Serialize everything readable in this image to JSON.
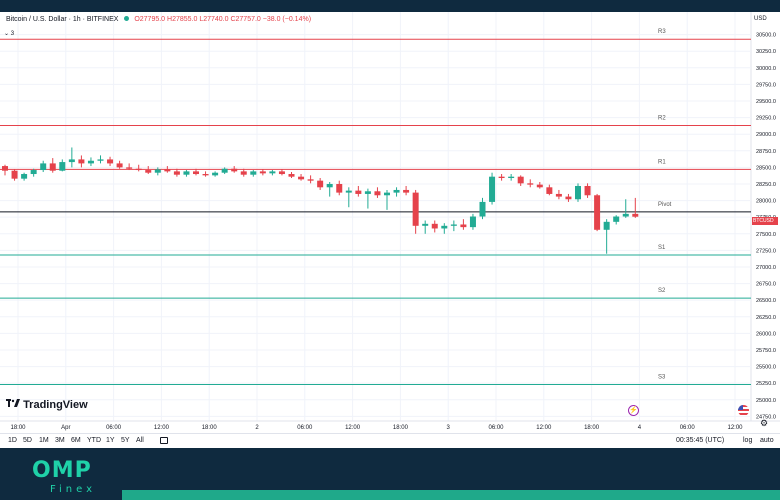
{
  "header": {
    "symbol": "Bitcoin / U.S. Dollar · 1h · BITFINEX",
    "ohlc": "O27795.0 H27855.0 L27740.0 C27757.0 −38.0 (−0.14%)",
    "indicator_count": "3",
    "currency": "USD"
  },
  "chart_data": {
    "type": "candlestick",
    "title": "Bitcoin / U.S. Dollar · 1h · BITFINEX",
    "y_ticks": [
      "30500.0",
      "30250.0",
      "30000.0",
      "29750.0",
      "29500.0",
      "29250.0",
      "29000.0",
      "28750.0",
      "28500.0",
      "28250.0",
      "28000.0",
      "27750.0",
      "27500.0",
      "27250.0",
      "27000.0",
      "26750.0",
      "26500.0",
      "26250.0",
      "26000.0",
      "25750.0",
      "25500.0",
      "25250.0",
      "25000.0",
      "24750.0"
    ],
    "ylim": [
      24650,
      30750
    ],
    "x_ticks": [
      "18:00",
      "Apr",
      "06:00",
      "12:00",
      "18:00",
      "2",
      "06:00",
      "12:00",
      "18:00",
      "3",
      "06:00",
      "12:00",
      "18:00",
      "4",
      "06:00",
      "12:00"
    ],
    "pivot_levels": [
      {
        "name": "R3",
        "value": 30430,
        "color": "#e5424b"
      },
      {
        "name": "R2",
        "value": 29130,
        "color": "#e5424b"
      },
      {
        "name": "R1",
        "value": 28470,
        "color": "#e5424b"
      },
      {
        "name": "Pivot",
        "value": 27830,
        "color": "#131722"
      },
      {
        "name": "S1",
        "value": 27180,
        "color": "#22ab94"
      },
      {
        "name": "S2",
        "value": 26530,
        "color": "#22ab94"
      },
      {
        "name": "S3",
        "value": 25230,
        "color": "#22ab94"
      }
    ],
    "candles": [
      [
        28520,
        28540,
        28380,
        28450
      ],
      [
        28450,
        28470,
        28300,
        28330
      ],
      [
        28330,
        28420,
        28300,
        28400
      ],
      [
        28400,
        28480,
        28360,
        28460
      ],
      [
        28460,
        28600,
        28430,
        28560
      ],
      [
        28560,
        28640,
        28420,
        28450
      ],
      [
        28450,
        28620,
        28440,
        28580
      ],
      [
        28580,
        28800,
        28500,
        28620
      ],
      [
        28620,
        28680,
        28500,
        28560
      ],
      [
        28560,
        28650,
        28520,
        28600
      ],
      [
        28600,
        28680,
        28560,
        28620
      ],
      [
        28620,
        28660,
        28520,
        28560
      ],
      [
        28560,
        28600,
        28480,
        28500
      ],
      [
        28500,
        28560,
        28460,
        28480
      ],
      [
        28480,
        28540,
        28440,
        28460
      ],
      [
        28460,
        28520,
        28400,
        28420
      ],
      [
        28420,
        28500,
        28380,
        28470
      ],
      [
        28470,
        28520,
        28420,
        28440
      ],
      [
        28440,
        28480,
        28360,
        28390
      ],
      [
        28390,
        28460,
        28360,
        28440
      ],
      [
        28440,
        28480,
        28380,
        28400
      ],
      [
        28400,
        28440,
        28360,
        28380
      ],
      [
        28380,
        28440,
        28360,
        28420
      ],
      [
        28420,
        28500,
        28400,
        28480
      ],
      [
        28480,
        28520,
        28420,
        28440
      ],
      [
        28440,
        28480,
        28360,
        28390
      ],
      [
        28390,
        28460,
        28360,
        28440
      ],
      [
        28440,
        28470,
        28380,
        28410
      ],
      [
        28410,
        28460,
        28380,
        28440
      ],
      [
        28440,
        28470,
        28380,
        28400
      ],
      [
        28400,
        28430,
        28340,
        28360
      ],
      [
        28360,
        28400,
        28300,
        28320
      ],
      [
        28320,
        28380,
        28260,
        28300
      ],
      [
        28300,
        28340,
        28160,
        28200
      ],
      [
        28200,
        28280,
        28060,
        28250
      ],
      [
        28250,
        28300,
        28080,
        28120
      ],
      [
        28120,
        28200,
        27900,
        28150
      ],
      [
        28150,
        28220,
        28060,
        28100
      ],
      [
        28100,
        28180,
        27880,
        28140
      ],
      [
        28140,
        28200,
        28040,
        28080
      ],
      [
        28080,
        28160,
        27860,
        28120
      ],
      [
        28120,
        28200,
        28060,
        28160
      ],
      [
        28160,
        28220,
        28080,
        28120
      ],
      [
        28120,
        28160,
        27500,
        27620
      ],
      [
        27620,
        27700,
        27500,
        27650
      ],
      [
        27650,
        27700,
        27520,
        27580
      ],
      [
        27580,
        27660,
        27500,
        27620
      ],
      [
        27620,
        27700,
        27540,
        27640
      ],
      [
        27640,
        27720,
        27560,
        27600
      ],
      [
        27600,
        27800,
        27560,
        27760
      ],
      [
        27760,
        28040,
        27720,
        27980
      ],
      [
        27980,
        28420,
        27940,
        28360
      ],
      [
        28360,
        28400,
        28300,
        28340
      ],
      [
        28340,
        28400,
        28300,
        28360
      ],
      [
        28360,
        28380,
        28220,
        28260
      ],
      [
        28260,
        28320,
        28200,
        28240
      ],
      [
        28240,
        28280,
        28180,
        28200
      ],
      [
        28200,
        28240,
        28080,
        28100
      ],
      [
        28100,
        28160,
        28020,
        28060
      ],
      [
        28060,
        28100,
        27980,
        28020
      ],
      [
        28020,
        28260,
        27980,
        28220
      ],
      [
        28220,
        28260,
        28040,
        28080
      ],
      [
        28080,
        28100,
        27540,
        27560
      ],
      [
        27560,
        27720,
        27200,
        27680
      ],
      [
        27680,
        27780,
        27640,
        27760
      ],
      [
        27760,
        28020,
        27740,
        27800
      ],
      [
        27800,
        28040,
        27740,
        27757
      ]
    ],
    "current_price_label": "BTCUSD",
    "current_price_value": "24:15"
  },
  "toolbar": {
    "timeframes": [
      "1D",
      "5D",
      "1M",
      "3M",
      "6M",
      "YTD",
      "1Y",
      "5Y",
      "All"
    ],
    "timezone": "00:35:45 (UTC)",
    "log_label": "log",
    "auto_label": "auto"
  },
  "brand": {
    "tv": "TradingView",
    "omp": "OMP",
    "finex": "Finex"
  }
}
